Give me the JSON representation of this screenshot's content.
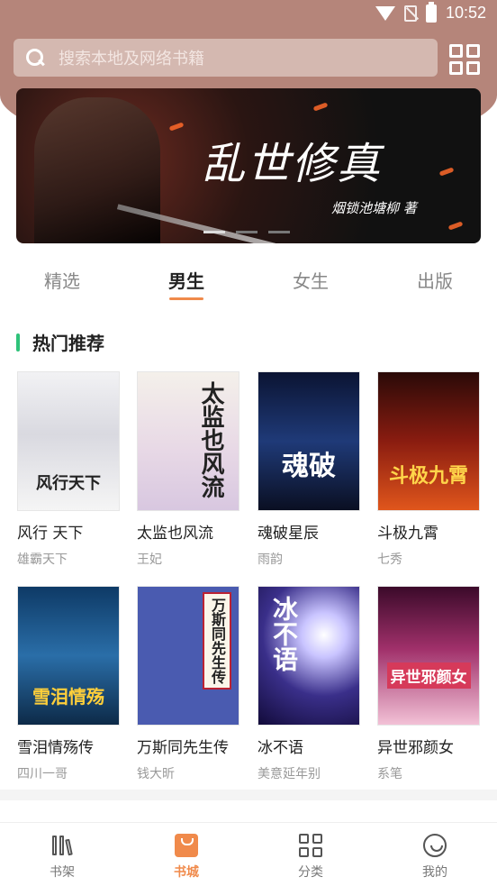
{
  "status_bar": {
    "time": "10:52"
  },
  "search": {
    "placeholder": "搜索本地及网络书籍"
  },
  "banner": {
    "title": "乱世修真",
    "author": "烟锁池塘柳 著"
  },
  "tabs": [
    {
      "label": "精选"
    },
    {
      "label": "男生"
    },
    {
      "label": "女生"
    },
    {
      "label": "出版"
    }
  ],
  "section": {
    "title": "热门推荐"
  },
  "books": [
    {
      "title": "风行 天下",
      "author": "雄霸天下",
      "cover_text": "风行天下"
    },
    {
      "title": "太监也风流",
      "author": "王妃",
      "cover_text": "太监也风流"
    },
    {
      "title": "魂破星辰",
      "author": "雨韵",
      "cover_text": "魂破"
    },
    {
      "title": "斗极九霄",
      "author": "七秀",
      "cover_text": "斗极九霄"
    },
    {
      "title": "雪泪情殇传",
      "author": "四川一哥",
      "cover_text": "雪泪情殇"
    },
    {
      "title": "万斯同先生传",
      "author": "钱大昕",
      "cover_text": "万斯同先生传"
    },
    {
      "title": "冰不语",
      "author": "美意延年别",
      "cover_text": "冰不语"
    },
    {
      "title": "异世邪颜女",
      "author": "系笔",
      "cover_text": "异世邪颜女"
    }
  ],
  "bottom_nav": [
    {
      "label": "书架",
      "icon": "bookshelf-icon"
    },
    {
      "label": "书城",
      "icon": "store-bag-icon"
    },
    {
      "label": "分类",
      "icon": "category-grid-icon"
    },
    {
      "label": "我的",
      "icon": "profile-smile-icon"
    }
  ],
  "colors": {
    "header": "#b5857a",
    "accent": "#f08a4b",
    "section_bar": "#2fc27a"
  }
}
